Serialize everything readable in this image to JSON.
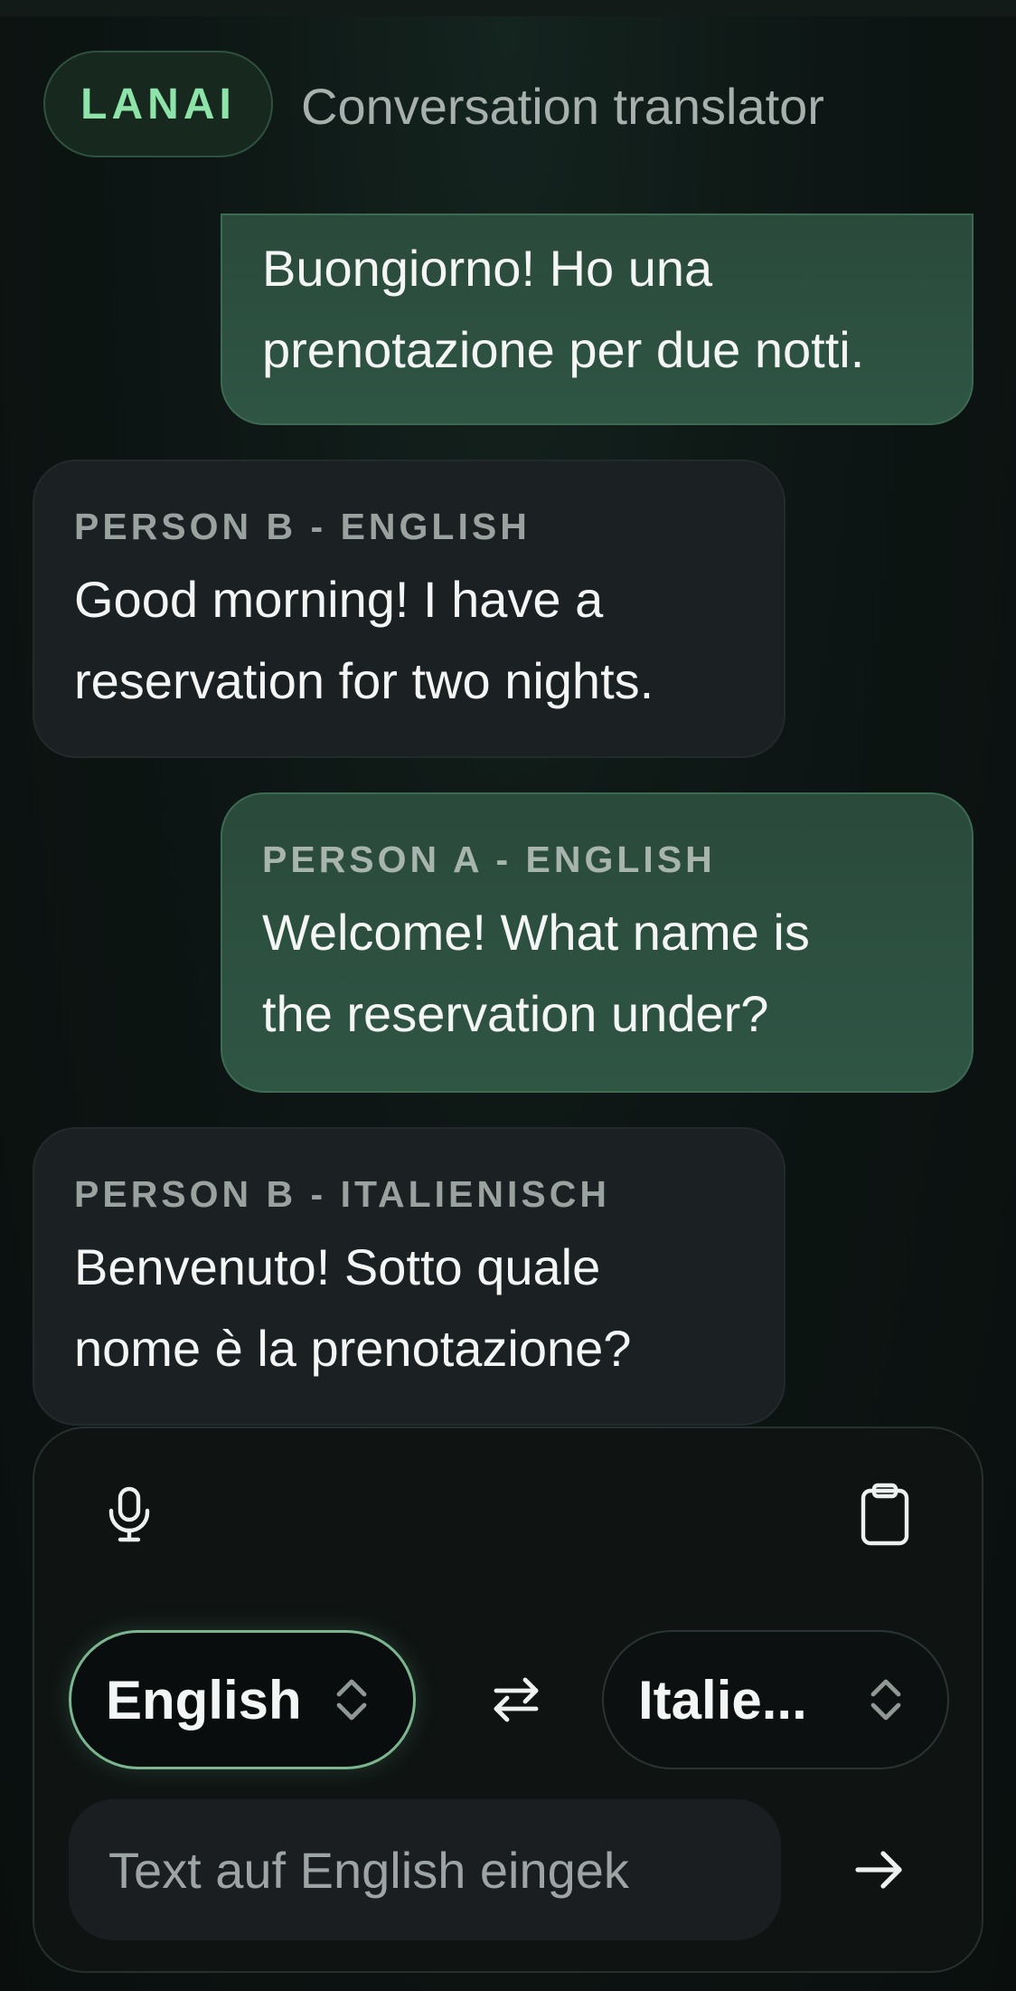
{
  "header": {
    "brand": "LANAI",
    "subtitle": "Conversation translator"
  },
  "messages": [
    {
      "speaker": "",
      "text_line1": "Buongiorno! Ho una",
      "text_line2": "prenotazione per due notti."
    },
    {
      "speaker": "PERSON B - ENGLISH",
      "text_line1": "Good morning! I have a",
      "text_line2": "reservation for two nights."
    },
    {
      "speaker": "PERSON A - ENGLISH",
      "text_line1": "Welcome! What name is",
      "text_line2": "the reservation under?"
    },
    {
      "speaker": "PERSON B - ITALIENISCH",
      "text_line1": "Benvenuto! Sotto quale",
      "text_line2": "nome è la prenotazione?"
    }
  ],
  "composer": {
    "source_language": "English",
    "target_language": "Italie...",
    "input_placeholder": "Text auf English eingek",
    "input_value": "",
    "icons": {
      "mic": "microphone-icon",
      "clipboard": "clipboard-icon",
      "swap": "swap-arrows-icon",
      "send": "arrow-right-icon",
      "select": "chevron-up-down-icon"
    }
  },
  "colors": {
    "accent": "#8de3a8",
    "bubble_a": "#2f5545",
    "bubble_b": "#1b2022",
    "background": "#0c1211"
  }
}
